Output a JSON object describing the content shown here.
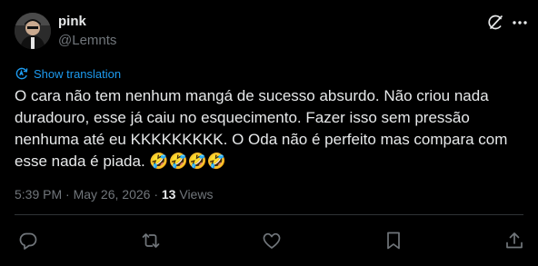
{
  "author": {
    "display_name": "pink",
    "handle": "@Lemnts"
  },
  "translate": {
    "label": "Show translation"
  },
  "post": {
    "text": "O cara não tem nenhum mangá de sucesso absurdo. Não criou nada duradouro, esse já caiu no esquecimento. Fazer isso sem pressão nenhuma até eu KKKKKKKKK. O Oda não é perfeito mas compara com esse nada é piada. 🤣🤣🤣🤣"
  },
  "meta": {
    "time": "5:39 PM",
    "separator": " · ",
    "date": "May 26, 2026",
    "views_count": "13",
    "views_label": " Views"
  },
  "icons": {
    "header": [
      "grok-icon",
      "more-icon"
    ],
    "actions": [
      "reply-icon",
      "retweet-icon",
      "like-icon",
      "bookmark-icon",
      "share-icon"
    ]
  },
  "colors": {
    "background": "#000000",
    "text": "#e7e9ea",
    "muted": "#71767b",
    "accent": "#1d9bf0",
    "divider": "#2f3336"
  }
}
